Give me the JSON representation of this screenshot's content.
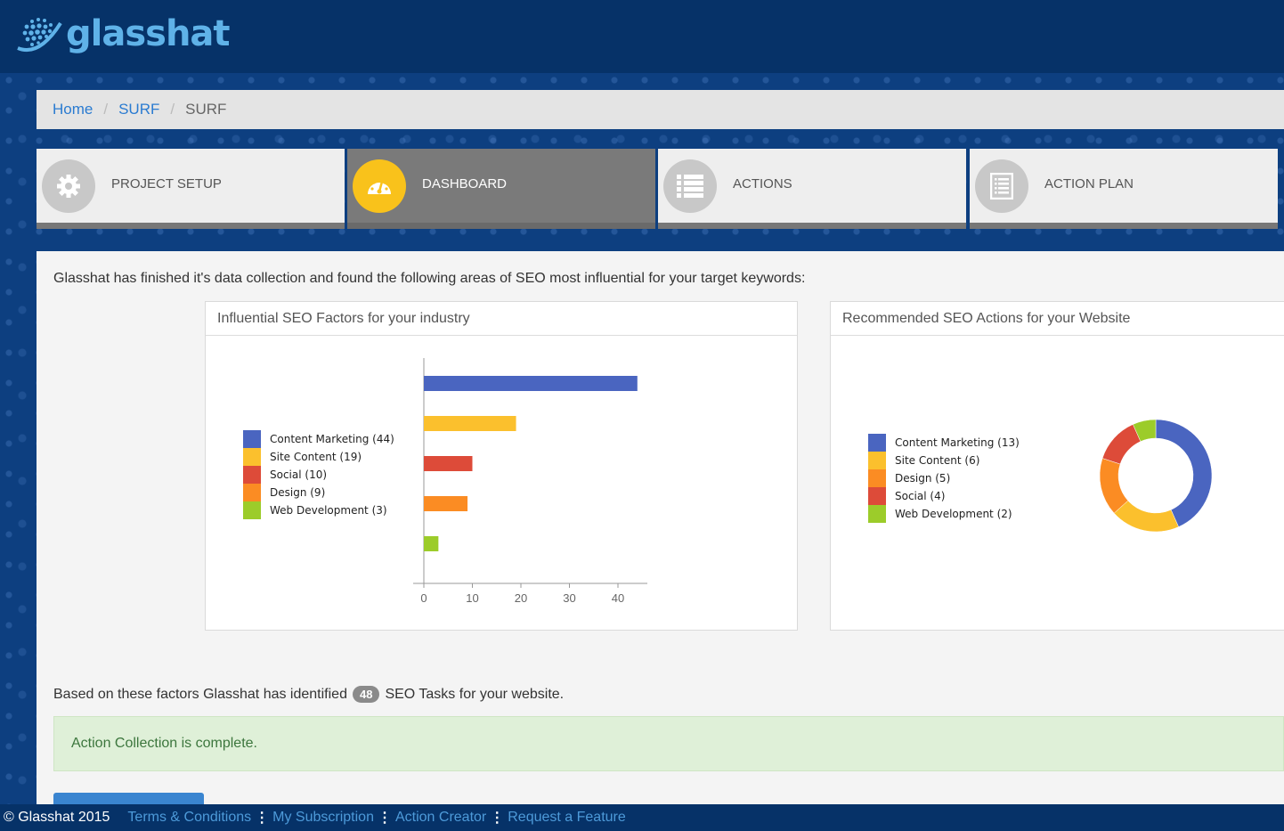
{
  "brand": {
    "name": "glasshat"
  },
  "breadcrumb": [
    "Home",
    "SURF",
    "SURF"
  ],
  "steps": [
    {
      "label": "PROJECT SETUP",
      "icon": "gear-icon"
    },
    {
      "label": "DASHBOARD",
      "icon": "speedometer-icon"
    },
    {
      "label": "ACTIONS",
      "icon": "list-icon"
    },
    {
      "label": "ACTION PLAN",
      "icon": "document-icon"
    }
  ],
  "intro": "Glasshat has finished it's data collection and found the following areas of SEO most influential for your target keywords:",
  "factors_card": {
    "title": "Influential SEO Factors for your industry"
  },
  "actions_card": {
    "title": "Recommended SEO Actions for your Website"
  },
  "tasks": {
    "prefix": "Based on these factors Glasshat has identified",
    "count": "48",
    "suffix": "SEO Tasks for your website."
  },
  "alert": "Action Collection is complete.",
  "footer": {
    "copyright": "© Glasshat 2015",
    "links": [
      "Terms & Conditions",
      "My Subscription",
      "Action Creator",
      "Request a Feature"
    ]
  },
  "chart_data": [
    {
      "type": "bar",
      "orientation": "horizontal",
      "categories": [
        "Content Marketing (44)",
        "Site Content (19)",
        "Social (10)",
        "Design (9)",
        "Web Development (3)"
      ],
      "values": [
        44,
        19,
        10,
        9,
        3
      ],
      "colors": [
        "#4a65c0",
        "#fbc02d",
        "#dd4b39",
        "#fb8c23",
        "#9ccc2a"
      ],
      "xticks": [
        "0",
        "10",
        "20",
        "30",
        "40"
      ],
      "xlim": [
        0,
        45
      ],
      "legend": "left"
    },
    {
      "type": "pie",
      "donut": true,
      "labels": [
        "Content Marketing (13)",
        "Site Content (6)",
        "Design (5)",
        "Social (4)",
        "Web Development (2)"
      ],
      "values": [
        13,
        6,
        5,
        4,
        2
      ],
      "colors": [
        "#4a65c0",
        "#fbc02d",
        "#fb8c23",
        "#dd4b39",
        "#9ccc2a"
      ],
      "legend": "left"
    }
  ]
}
